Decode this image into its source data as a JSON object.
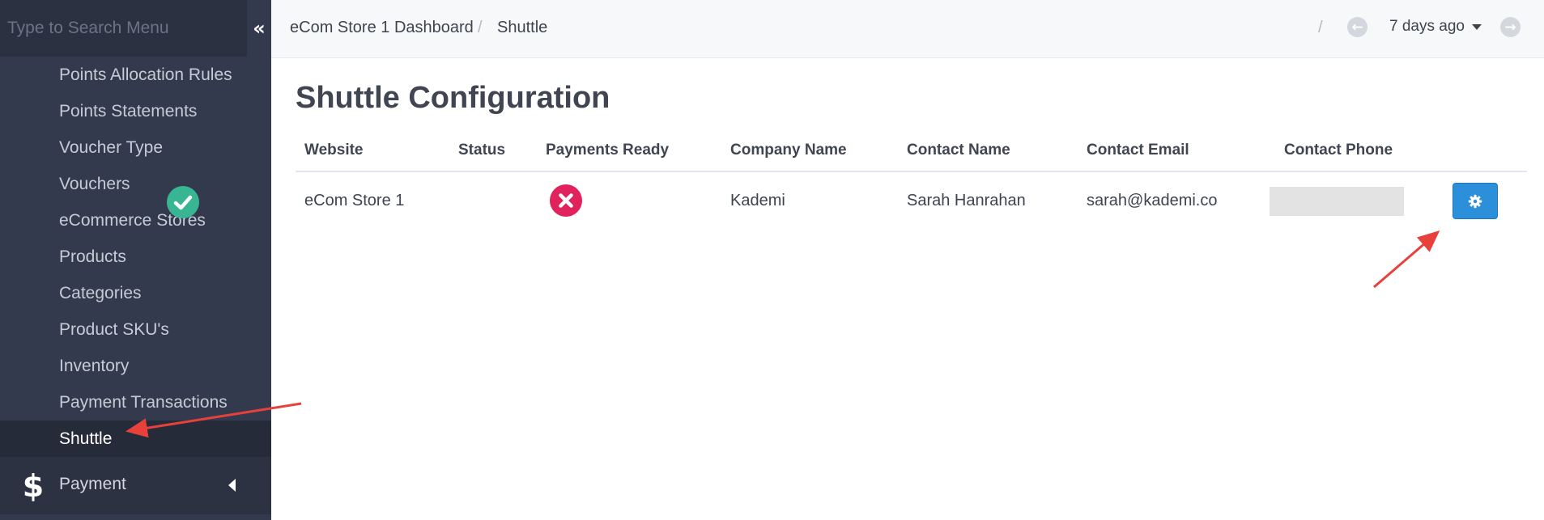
{
  "sidebar": {
    "search": {
      "placeholder": "Type to Search Menu"
    },
    "collapse_icon": "chevron-double-left-icon",
    "items": [
      {
        "label": "Points Allocation Rules"
      },
      {
        "label": "Points Statements"
      },
      {
        "label": "Voucher Type"
      },
      {
        "label": "Vouchers"
      },
      {
        "label": "eCommerce Stores"
      },
      {
        "label": "Products"
      },
      {
        "label": "Categories"
      },
      {
        "label": "Product SKU's"
      },
      {
        "label": "Inventory"
      },
      {
        "label": "Payment Transactions"
      },
      {
        "label": "Shuttle",
        "active": true
      }
    ],
    "parent": {
      "label": "Payment",
      "icon": "dollar-icon"
    }
  },
  "topbar": {
    "breadcrumbs": [
      "eCom Store 1 Dashboard",
      "Shuttle"
    ],
    "separator": "/",
    "date_range": "7 days ago"
  },
  "main": {
    "title": "Shuttle Configuration",
    "table": {
      "columns": [
        "Website",
        "Status",
        "Payments Ready",
        "Company Name",
        "Contact Name",
        "Contact Email",
        "Contact Phone"
      ],
      "rows": [
        {
          "website": "eCom Store 1",
          "status": "check-icon",
          "payments_ready": "cross-icon",
          "company_name": "Kademi",
          "contact_name": "Sarah Hanrahan",
          "contact_email": "sarah@kademi.co",
          "contact_phone": ""
        }
      ]
    }
  },
  "colors": {
    "sidebar_bg": "#343a4e",
    "status_ok": "#38b593",
    "status_error": "#e0235c",
    "button_primary": "#2c8fd9",
    "annotation_arrow": "#e8403a"
  }
}
